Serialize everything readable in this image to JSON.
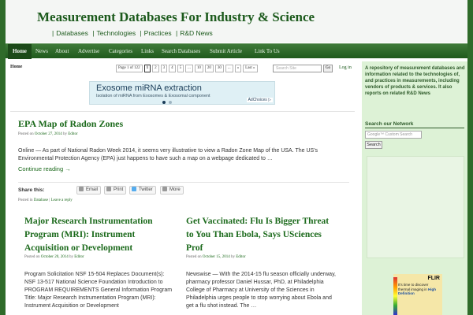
{
  "header": {
    "site_title": "Measurement Databases For Industry & Science",
    "topnav": [
      "Databases",
      "Technologies",
      "Practices",
      "R&D News"
    ]
  },
  "navbar": {
    "items": [
      "Home",
      "News",
      "About",
      "Advertise",
      "Categories",
      "Links",
      "Search Databases",
      "Submit Article",
      "Link To Us"
    ]
  },
  "content": {
    "breadcrumb": "Home",
    "pagination": {
      "label": "Page 1 of 122",
      "pages": [
        "1",
        "2",
        "3",
        "4",
        "5",
        "...",
        "10",
        "20",
        "30",
        "...",
        "»",
        "Last »"
      ],
      "current": "1"
    },
    "search_placeholder": "Search Site",
    "search_button": "Go",
    "login_label": "Log in",
    "ad": {
      "title": "Exosome miRNA extraction",
      "subtitle": "Isolation of miRNA from Exosomes & Exosomal component",
      "adchoices": "AdChoices ▷"
    },
    "featured_post": {
      "title": "EPA Map of Radon Zones",
      "meta_prefix": "Posted on",
      "date": "October 27, 2014",
      "meta_by": "by",
      "author": "Editor",
      "excerpt": "Online  —  As part of National Radon Week 2014, it seems very illustrative to view a Radon Zone Map of the USA. The US's Environmental Protection Agency (EPA) just happens to have such a map on a webpage dedicated to …",
      "continue_label": "Continue reading →",
      "footer_prefix": "Posted in",
      "category": "Database",
      "footer_sep": "|",
      "reply_label": "Leave a reply"
    },
    "share": {
      "label": "Share this:",
      "buttons": [
        "Email",
        "Print",
        "Twitter",
        "More"
      ]
    },
    "posts": [
      {
        "title": "Major Research Instrumentation Program (MRI): Instrument Acquisition or Development",
        "meta_prefix": "Posted on",
        "date": "October 20, 2014",
        "meta_by": "by",
        "author": "Editor",
        "excerpt": "Program Solicitation  NSF 15-504 Replaces Document(s): NSF 13-517 National Science Foundation Introduction to PROGRAM REQUIREMENTS General Information Program Title: Major Research Instrumentation Program (MRI): Instrument Acquisition or Development"
      },
      {
        "title": "Get Vaccinated: Flu Is Bigger Threat to You Than Ebola, Says USciences Prof",
        "meta_prefix": "Posted on",
        "date": "October 15, 2014",
        "meta_by": "by",
        "author": "Editor",
        "excerpt": "Newswise — With the 2014-15 flu season officially underway, pharmacy professor Daniel Hussar, PhD, at Philadelphia College of Pharmacy at University of the Sciences in Philadelphia urges people to stop worrying about Ebola and get a flu shot instead. The …"
      }
    ]
  },
  "sidebar": {
    "about": "A repository of measurement databases and information related to the technologies of, and practices in measurements, including vendors of products & services. It also reports on related R&D News",
    "network_heading": "Search our Network",
    "google_placeholder": "Google™ Custom Search",
    "search_button": "Search",
    "flir_ad": {
      "logo": "FLIR",
      "line1": "It's time to discover thermal imaging in",
      "highlight": "High Definition"
    }
  },
  "colors": {
    "brand_green": "#1c5a1c",
    "nav_bar": "#2f6b2a",
    "sidebar_bg": "#ddf2d6"
  }
}
